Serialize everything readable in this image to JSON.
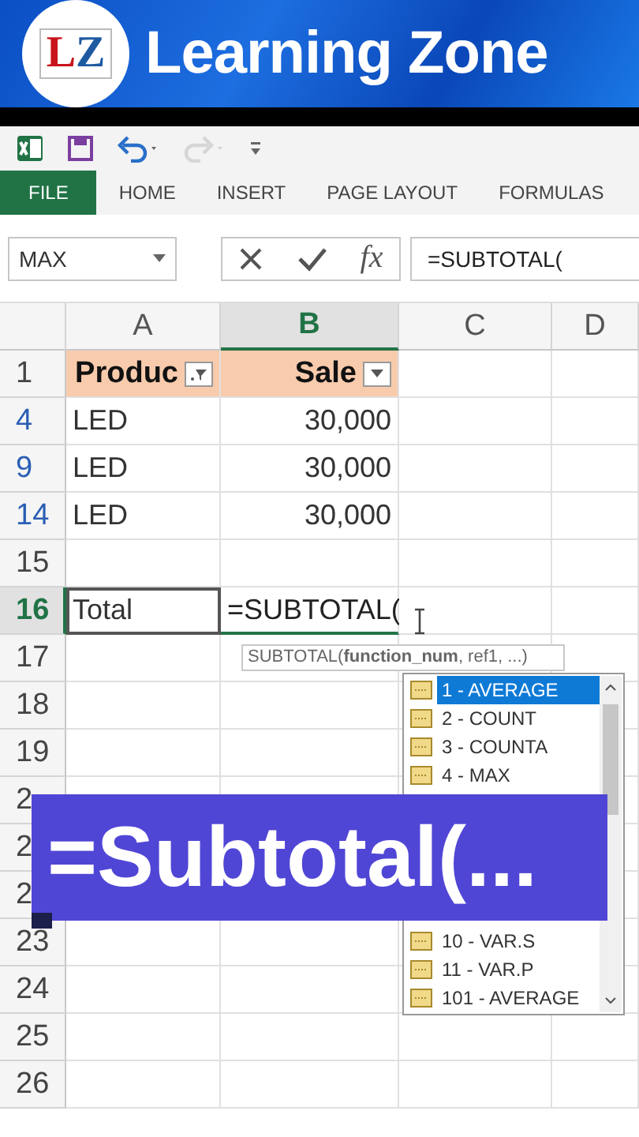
{
  "banner": {
    "logo": [
      {
        "char": "L",
        "color": "#c8141c"
      },
      {
        "char": "Z",
        "color": "#1e5aa0"
      }
    ],
    "title": "Learning Zone"
  },
  "quick_access": [
    {
      "kind": "excel"
    },
    {
      "kind": "save"
    },
    {
      "kind": "undo",
      "disabled": false
    },
    {
      "kind": "redo",
      "disabled": true
    },
    {
      "kind": "customize"
    }
  ],
  "ribbon_tabs": [
    {
      "label": "FILE",
      "selected": true
    },
    {
      "label": "HOME",
      "selected": false
    },
    {
      "label": "INSERT",
      "selected": false
    },
    {
      "label": "PAGE LAYOUT",
      "selected": false
    },
    {
      "label": "FORMULAS",
      "selected": false
    }
  ],
  "formula_bar": {
    "name_box": "MAX",
    "fx_label": "fx",
    "formula": "=SUBTOTAL("
  },
  "sheet": {
    "columns": [
      {
        "label": "A",
        "selected": false
      },
      {
        "label": "B",
        "selected": true
      },
      {
        "label": "C",
        "selected": false
      },
      {
        "label": "D",
        "selected": false
      }
    ],
    "rows": [
      {
        "header": "1",
        "filtered": false,
        "active": false,
        "cells": [
          {
            "kind": "header",
            "text": "Produc",
            "filtered": true,
            "selected": false
          },
          {
            "kind": "header",
            "text": "Sale",
            "filtered": false,
            "selected": false
          }
        ]
      },
      {
        "header": "4",
        "filtered": true,
        "active": false,
        "cells": [
          {
            "kind": "text",
            "text": "LED",
            "selected": false
          },
          {
            "kind": "number",
            "text": "30,000",
            "selected": false
          }
        ]
      },
      {
        "header": "9",
        "filtered": true,
        "active": false,
        "cells": [
          {
            "kind": "text",
            "text": "LED",
            "selected": false
          },
          {
            "kind": "number",
            "text": "30,000",
            "selected": false
          }
        ]
      },
      {
        "header": "14",
        "filtered": true,
        "active": false,
        "cells": [
          {
            "kind": "text",
            "text": "LED",
            "selected": false
          },
          {
            "kind": "number",
            "text": "30,000",
            "selected": false
          }
        ]
      },
      {
        "header": "15",
        "filtered": false,
        "active": false,
        "cells": []
      },
      {
        "header": "16",
        "filtered": false,
        "active": true,
        "cells": [
          {
            "kind": "text",
            "text": "Total",
            "selected": true
          },
          {
            "kind": "formula",
            "text": "=SUBTOTAL(",
            "selected": false
          }
        ]
      },
      {
        "header": "17",
        "filtered": false,
        "active": false,
        "cells": []
      },
      {
        "header": "18",
        "filtered": false,
        "active": false,
        "cells": []
      },
      {
        "header": "19",
        "filtered": false,
        "active": false,
        "cells": []
      },
      {
        "header": "2",
        "filtered": false,
        "active": false,
        "cells": []
      },
      {
        "header": "2",
        "filtered": false,
        "active": false,
        "cells": []
      },
      {
        "header": "2",
        "filtered": false,
        "active": false,
        "cells": []
      },
      {
        "header": "23",
        "filtered": false,
        "active": false,
        "cells": []
      },
      {
        "header": "24",
        "filtered": false,
        "active": false,
        "cells": []
      },
      {
        "header": "25",
        "filtered": false,
        "active": false,
        "cells": []
      },
      {
        "header": "26",
        "filtered": false,
        "active": false,
        "cells": []
      }
    ]
  },
  "tooltip": "SUBTOTAL(**function_num**, ref1, ...)",
  "autocomplete": {
    "items_above": [
      {
        "label": "1 - AVERAGE",
        "selected": true
      },
      {
        "label": "2 - COUNT",
        "selected": false
      },
      {
        "label": "3 - COUNTA",
        "selected": false
      },
      {
        "label": "4 - MAX",
        "selected": false
      }
    ],
    "items_below": [
      {
        "label": "10 - VAR.S",
        "selected": false
      },
      {
        "label": "11 - VAR.P",
        "selected": false
      },
      {
        "label": "101 - AVERAGE",
        "selected": false
      }
    ]
  },
  "caption": "=Subtotal(..."
}
